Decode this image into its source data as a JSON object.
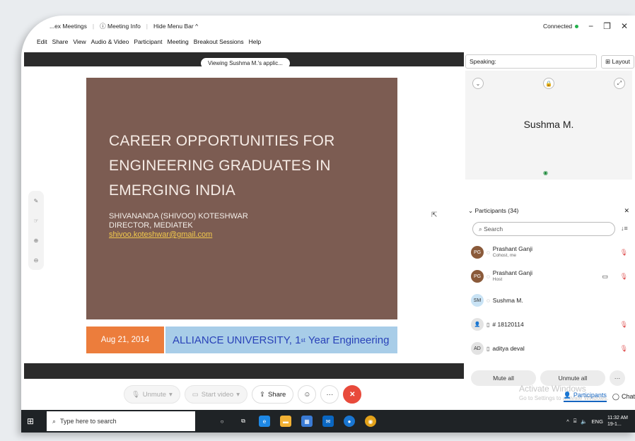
{
  "titlebar": {
    "meetings_label": "...ex Meetings",
    "meeting_info_label": "Meeting Info",
    "hide_menu_label": "Hide Menu Bar ^",
    "status_label": "Connected",
    "status_color": "#22b14c"
  },
  "menubar": {
    "items": [
      "Edit",
      "Share",
      "View",
      "Audio & Video",
      "Participant",
      "Meeting",
      "Breakout Sessions",
      "Help"
    ]
  },
  "stage": {
    "viewing_label": "Viewing Sushma M.'s applic...",
    "slide": {
      "title": "CAREER OPPORTUNITIES FOR ENGINEERING GRADUATES IN EMERGING INDIA",
      "author_line1": "SHIVANANDA (SHIVOO) KOTESHWAR",
      "author_line2": "DIRECTOR, MEDIATEK",
      "email": "shivoo.koteshwar@gmail.com",
      "date": "Aug 21, 2014",
      "university": "ALLIANCE UNIVERSITY, 1st Year Engineering",
      "colors": {
        "brown": "#7c5c52",
        "orange": "#ec7d3c",
        "blue": "#a8cde8"
      }
    }
  },
  "controls": {
    "unmute_label": "Unmute",
    "start_video_label": "Start video",
    "share_label": "Share",
    "end_color": "#e84a3b"
  },
  "panel": {
    "speaking_label": "Speaking:",
    "layout_label": "Layout",
    "video_name": "Sushma M.",
    "participants_header": "Participants (34)",
    "search_placeholder": "Search",
    "participants": [
      {
        "initials": "",
        "name": "Prashant Ganji",
        "role": "Cohost, me",
        "muted": true,
        "camera": false
      },
      {
        "initials": "",
        "name": "Prashant Ganji",
        "role": "Host",
        "muted": true,
        "camera": true
      },
      {
        "initials": "SM",
        "name": "Sushma M.",
        "role": "",
        "muted": false,
        "camera": false
      },
      {
        "initials": "",
        "name": "# 18120114",
        "role": "",
        "muted": true,
        "camera": false
      },
      {
        "initials": "AD",
        "name": "aditya deval",
        "role": "",
        "muted": true,
        "camera": false
      }
    ],
    "mute_all_label": "Mute all",
    "unmute_all_label": "Unmute all",
    "watermark_title": "Activate Windows",
    "watermark_sub": "Go to Settings to activate Windows.",
    "tab_participants": "Participants",
    "tab_chat": "Chat"
  },
  "taskbar": {
    "search_placeholder": "Type here to search",
    "time": "11:32 AM",
    "date_partial": "19-1...",
    "lang": "ENG"
  }
}
